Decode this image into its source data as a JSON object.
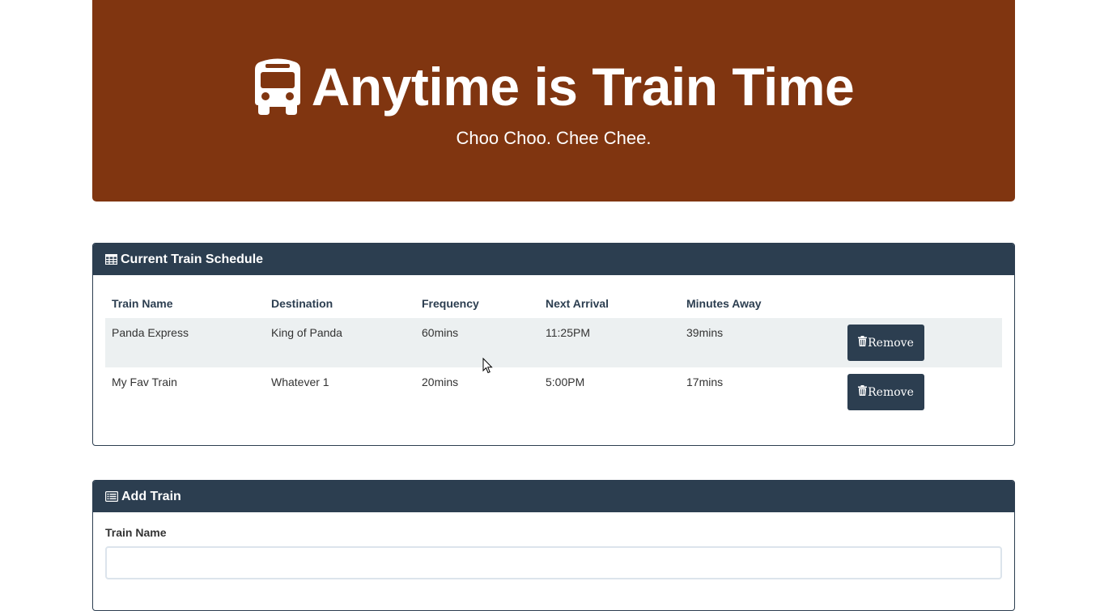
{
  "header": {
    "title": "Anytime is Train Time",
    "subtitle": "Choo Choo. Chee Chee.",
    "icon": "bus-icon",
    "background_color": "#803510"
  },
  "schedule_panel": {
    "title": "Current Train Schedule",
    "icon": "table-icon",
    "columns": [
      "Train Name",
      "Destination",
      "Frequency",
      "Next Arrival",
      "Minutes Away"
    ],
    "rows": [
      {
        "name": "Panda Express",
        "destination": "King of Panda",
        "frequency": "60mins",
        "next_arrival": "11:25PM",
        "minutes_away": "39mins",
        "remove_label": "Remove"
      },
      {
        "name": "My Fav Train",
        "destination": "Whatever 1",
        "frequency": "20mins",
        "next_arrival": "5:00PM",
        "minutes_away": "17mins",
        "remove_label": "Remove"
      }
    ]
  },
  "add_panel": {
    "title": "Add Train",
    "icon": "list-alt-icon",
    "train_name_label": "Train Name",
    "train_name_value": ""
  },
  "colors": {
    "panel_header": "#2c3e50",
    "stripe": "#ecf0f1"
  }
}
